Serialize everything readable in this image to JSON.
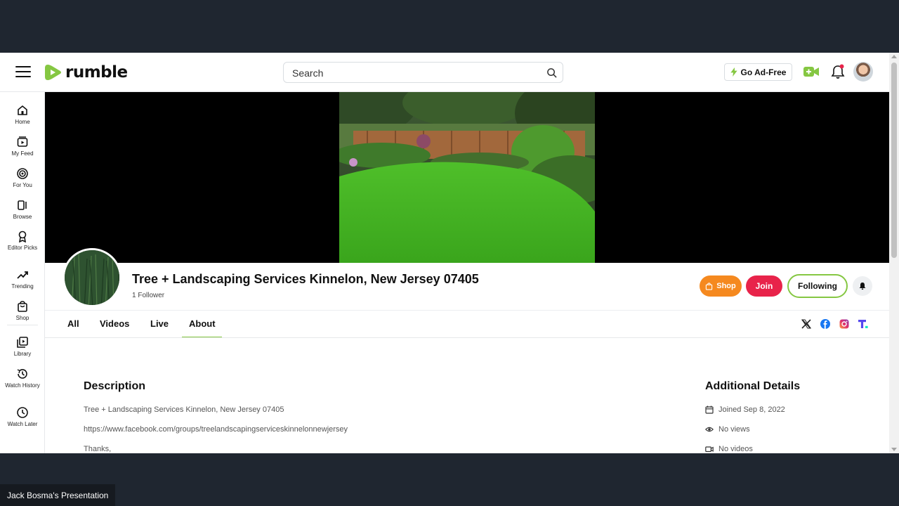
{
  "header": {
    "logo_text": "rumble",
    "search_placeholder": "Search",
    "go_ad_free_label": "Go Ad-Free",
    "brand_color": "#85c742"
  },
  "sidebar": {
    "items": [
      {
        "label": "Home",
        "icon": "home-icon"
      },
      {
        "label": "My Feed",
        "icon": "feed-icon"
      },
      {
        "label": "For You",
        "icon": "target-icon"
      },
      {
        "label": "Browse",
        "icon": "browse-icon"
      },
      {
        "label": "Editor Picks",
        "icon": "award-icon"
      },
      {
        "label": "Trending",
        "icon": "trending-icon"
      },
      {
        "label": "Shop",
        "icon": "shop-icon"
      },
      {
        "label": "Library",
        "icon": "library-icon"
      },
      {
        "label": "Watch History",
        "icon": "history-icon"
      },
      {
        "label": "Watch Later",
        "icon": "clock-icon"
      }
    ]
  },
  "channel": {
    "title": "Tree + Landscaping Services Kinnelon, New Jersey 07405",
    "followers": "1 Follower",
    "shop_label": "Shop",
    "join_label": "Join",
    "following_label": "Following",
    "shop_color": "#f5891f",
    "join_color": "#e8234a"
  },
  "tabs": [
    {
      "label": "All",
      "active": false
    },
    {
      "label": "Videos",
      "active": false
    },
    {
      "label": "Live",
      "active": false
    },
    {
      "label": "About",
      "active": true
    }
  ],
  "social_icons": [
    "x-icon",
    "facebook-icon",
    "instagram-icon",
    "truth-social-icon"
  ],
  "about": {
    "description_heading": "Description",
    "description_lines": [
      "Tree + Landscaping Services Kinnelon, New Jersey 07405",
      "https://www.facebook.com/groups/treelandscapingserviceskinnelonnewjersey",
      "Thanks,"
    ],
    "details_heading": "Additional Details",
    "joined": "Joined Sep 8, 2022",
    "views": "No views",
    "videos": "No videos"
  },
  "presenter_label": "Jack Bosma's Presentation"
}
